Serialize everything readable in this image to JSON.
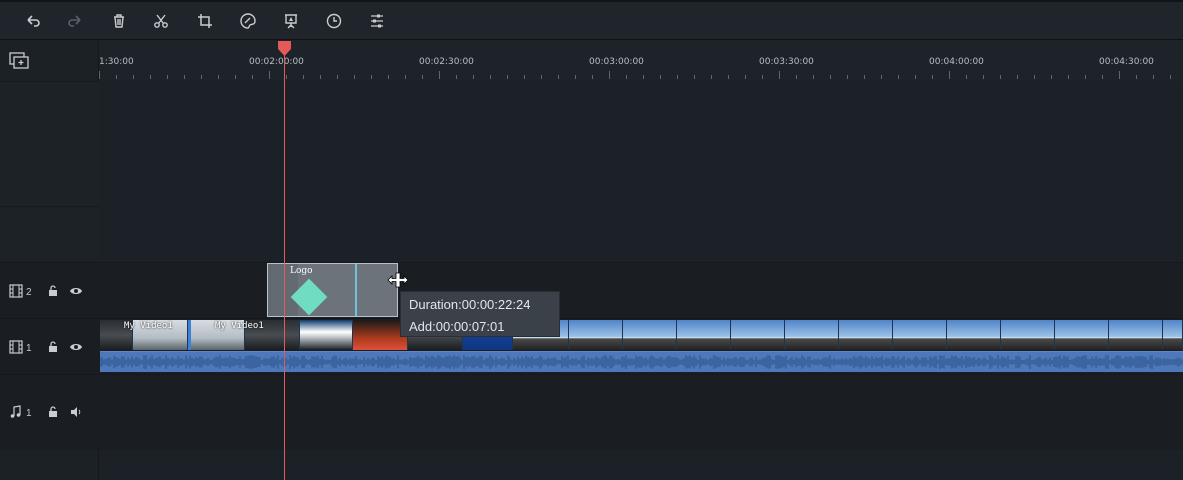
{
  "toolbar": {
    "buttons": [
      {
        "name": "undo",
        "icon": "undo-icon"
      },
      {
        "name": "redo",
        "icon": "redo-icon"
      },
      {
        "name": "delete",
        "icon": "trash-icon"
      },
      {
        "name": "split",
        "icon": "scissors-icon"
      },
      {
        "name": "crop",
        "icon": "crop-icon"
      },
      {
        "name": "color",
        "icon": "palette-icon"
      },
      {
        "name": "presentation",
        "icon": "presentation-icon"
      },
      {
        "name": "speed",
        "icon": "clock-icon"
      },
      {
        "name": "adjust",
        "icon": "sliders-icon"
      }
    ]
  },
  "ruler": {
    "labels": [
      "1:30:00",
      "00:02:00:00",
      "00:02:30:00",
      "00:03:00:00",
      "00:03:30:00",
      "00:04:00:00",
      "00:04:30:00"
    ]
  },
  "tracks": {
    "video2": {
      "number": "2"
    },
    "video1": {
      "number": "1"
    },
    "audio1": {
      "number": "1"
    }
  },
  "clips": {
    "logo": {
      "label": "Logo"
    },
    "video_labels": [
      "My Video1",
      "My Video1"
    ]
  },
  "tooltip": {
    "duration": "Duration:00:00:22:24",
    "add": "Add:00:00:07:01"
  },
  "colors": {
    "playhead": "#e45a5a",
    "logo_clip": "#6c737b",
    "video_clip": "#3b82d6",
    "audio_clip": "#4d79bb",
    "accent_teal": "#70dcc0"
  }
}
